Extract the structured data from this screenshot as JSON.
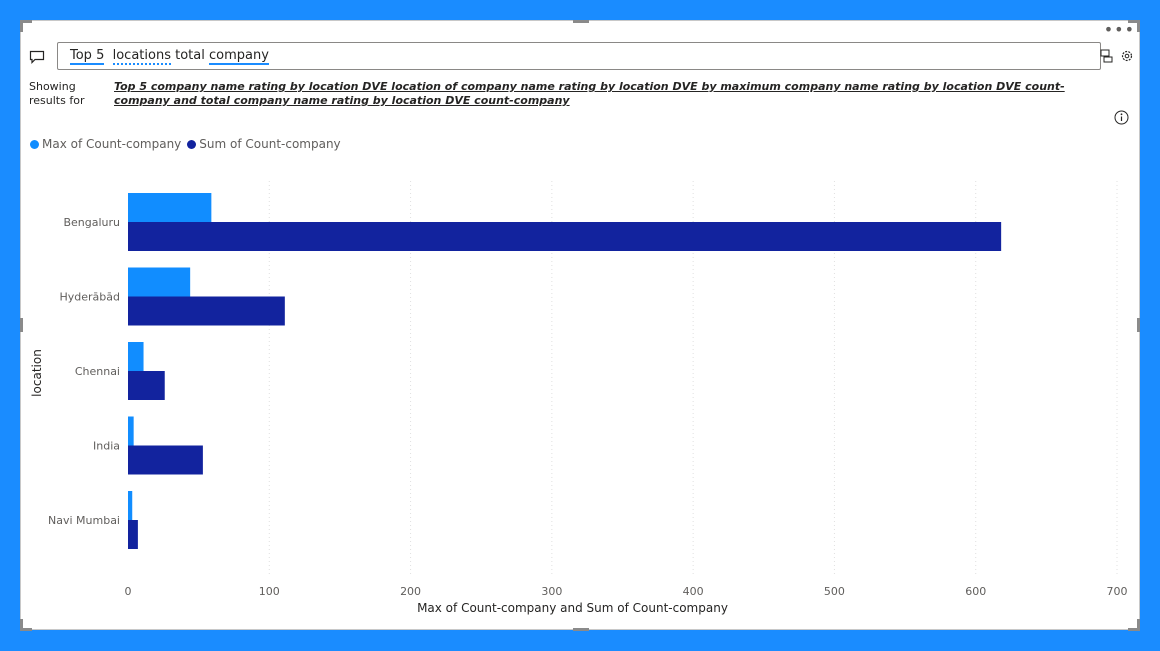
{
  "qa": {
    "query_parts": [
      "Top 5",
      "locations",
      "total",
      "company"
    ],
    "showing_label": "Showing results for",
    "restatement": "Top 5 company name rating by location DVE location of company name rating by location DVE by maximum company name rating by location DVE count-company and total company name rating by location DVE count-company"
  },
  "icons": {
    "chat": "chat-bubble-icon",
    "convert": "convert-visual-icon",
    "settings": "gear-icon",
    "info": "info-icon",
    "more": "more-options-icon"
  },
  "colors": {
    "frame": "#1a8cff",
    "series_max": "#118dff",
    "series_sum": "#12239e"
  },
  "chart_data": {
    "type": "bar",
    "orientation": "horizontal",
    "categories": [
      "Bengaluru",
      "Hyderābād",
      "Chennai",
      "India",
      "Navi Mumbai"
    ],
    "series": [
      {
        "name": "Max of Count-company",
        "color": "#118dff",
        "values": [
          59,
          44,
          11,
          4,
          3
        ]
      },
      {
        "name": "Sum of Count-company",
        "color": "#12239e",
        "values": [
          618,
          111,
          26,
          53,
          7
        ]
      }
    ],
    "xlabel": "Max of Count-company and Sum of Count-company",
    "ylabel": "location",
    "xlim": [
      0,
      700
    ],
    "xticks": [
      0,
      100,
      200,
      300,
      400,
      500,
      600,
      700
    ],
    "grid": "vertical dotted",
    "legend_position": "top-left"
  }
}
